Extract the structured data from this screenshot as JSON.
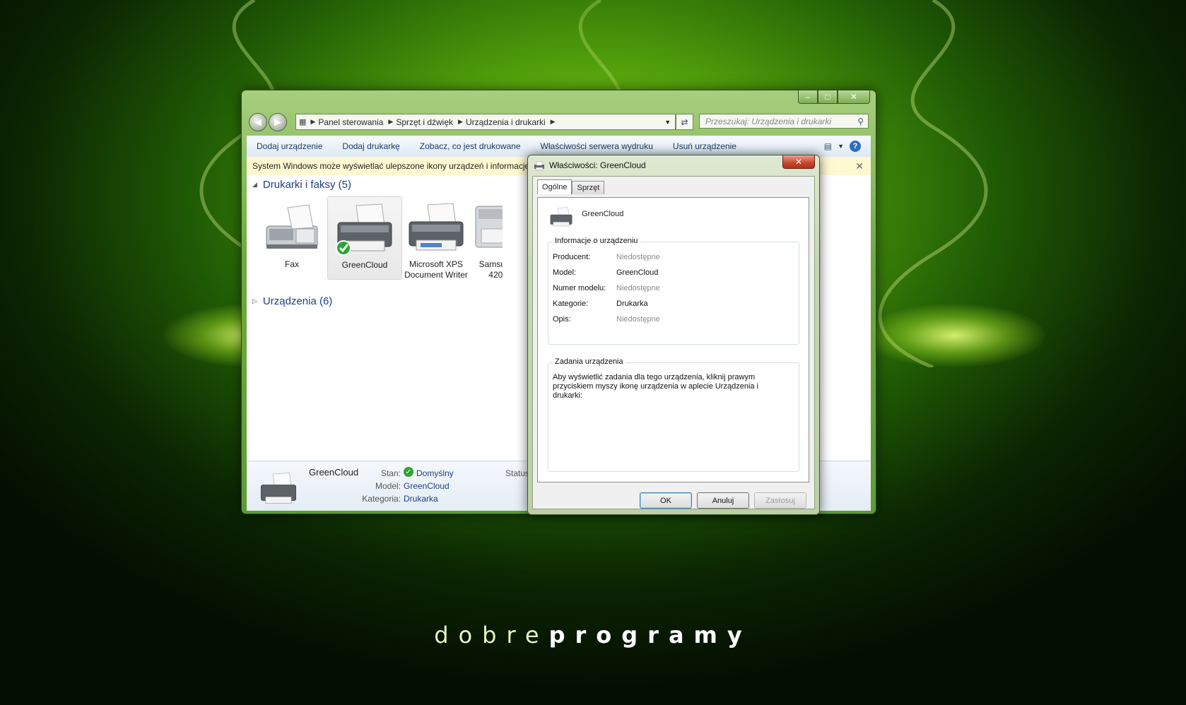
{
  "brand": {
    "light": "dobre",
    "bold": "programy"
  },
  "window": {
    "address": {
      "crumbs": [
        "Panel sterowania",
        "Sprzęt i dźwięk",
        "Urządzenia i drukarki"
      ]
    },
    "search_placeholder": "Przeszukaj: Urządzenia i drukarki",
    "toolbar": [
      "Dodaj urządzenie",
      "Dodaj drukarkę",
      "Zobacz, co jest drukowane",
      "Właściwości serwera wydruku",
      "Usuń urządzenie"
    ],
    "info_bar": "System Windows może wyświetlać ulepszone ikony urządzeń i informacje",
    "groups": {
      "printers": "Drukarki i faksy (5)",
      "devices": "Urządzenia (6)"
    },
    "tiles": [
      {
        "label": "Fax"
      },
      {
        "label": "GreenCloud"
      },
      {
        "label": "Microsoft XPS Document Writer"
      },
      {
        "label": "Samsung SCX-4200 na H"
      }
    ],
    "details": {
      "name": "GreenCloud",
      "state_label": "Stan:",
      "state_value": "Domyślny",
      "model_label": "Model:",
      "model_value": "GreenCloud",
      "category_label": "Kategoria:",
      "category_value": "Drukarka",
      "status_label": "Status"
    }
  },
  "dialog": {
    "title": "Właściwości: GreenCloud",
    "tabs": [
      "Ogólne",
      "Sprzęt"
    ],
    "device_name": "GreenCloud",
    "info_group": "Informacje o urządzeniu",
    "rows": [
      {
        "key": "Producent:",
        "value": "Niedostępne"
      },
      {
        "key": "Model:",
        "value": "GreenCloud"
      },
      {
        "key": "Numer modelu:",
        "value": "Niedostępne"
      },
      {
        "key": "Kategorie:",
        "value": "Drukarka"
      },
      {
        "key": "Opis:",
        "value": "Niedostępne"
      }
    ],
    "tasks_group": "Zadania urządzenia",
    "tasks_text": "Aby wyświetlić zadania dla tego urządzenia, kliknij prawym przyciskiem myszy ikonę urządzenia w aplecie Urządzenia i drukarki:",
    "buttons": {
      "ok": "OK",
      "cancel": "Anuluj",
      "apply": "Zastosuj"
    }
  }
}
